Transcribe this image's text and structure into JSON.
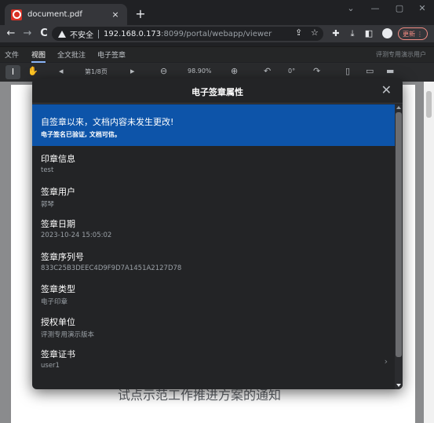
{
  "browser": {
    "tab_title": "document.pdf",
    "tab_close": "×",
    "new_tab": "+",
    "window_controls": [
      "⌄",
      "—",
      "▢",
      "✕"
    ],
    "nav": {
      "back": "←",
      "forward": "→",
      "reload": "C"
    },
    "security_label": "不安全",
    "url_host": "192.168.0.173",
    "url_path": ":8099/portal/webapp/viewer",
    "update_label": "更新",
    "icons": [
      "share-icon",
      "star-icon",
      "extensions-icon",
      "download-icon",
      "sidepanel-icon",
      "profile-icon",
      "menu-icon"
    ]
  },
  "app": {
    "menu": [
      "文件",
      "视图",
      "全文批注",
      "电子签章"
    ],
    "active_menu": "视图",
    "user_label": "评测专用演示用户",
    "page_indicator": "第1/8页",
    "zoom": "98.90%",
    "rotation": "0°"
  },
  "document": {
    "visible_text": "试点示范工作推进方案的通知"
  },
  "modal": {
    "title": "电子签章属性",
    "close": "✕",
    "banner": {
      "headline": "自签章以来，文档内容未发生更改!",
      "subline": "电子签名已验证, 文档可信。",
      "color": "#0d54a9"
    },
    "fields": [
      {
        "label": "印章信息",
        "value": "test"
      },
      {
        "label": "签章用户",
        "value": "郭琴"
      },
      {
        "label": "签章日期",
        "value": "2023-10-24 15:05:02"
      },
      {
        "label": "签章序列号",
        "value": "833C25B3DEEC4D9F9D7A1451A2127D78"
      },
      {
        "label": "签章类型",
        "value": "电子印章"
      },
      {
        "label": "授权单位",
        "value": "评测专用演示版本"
      },
      {
        "label": "签章证书",
        "value": "user1"
      }
    ],
    "chevron": "›"
  }
}
